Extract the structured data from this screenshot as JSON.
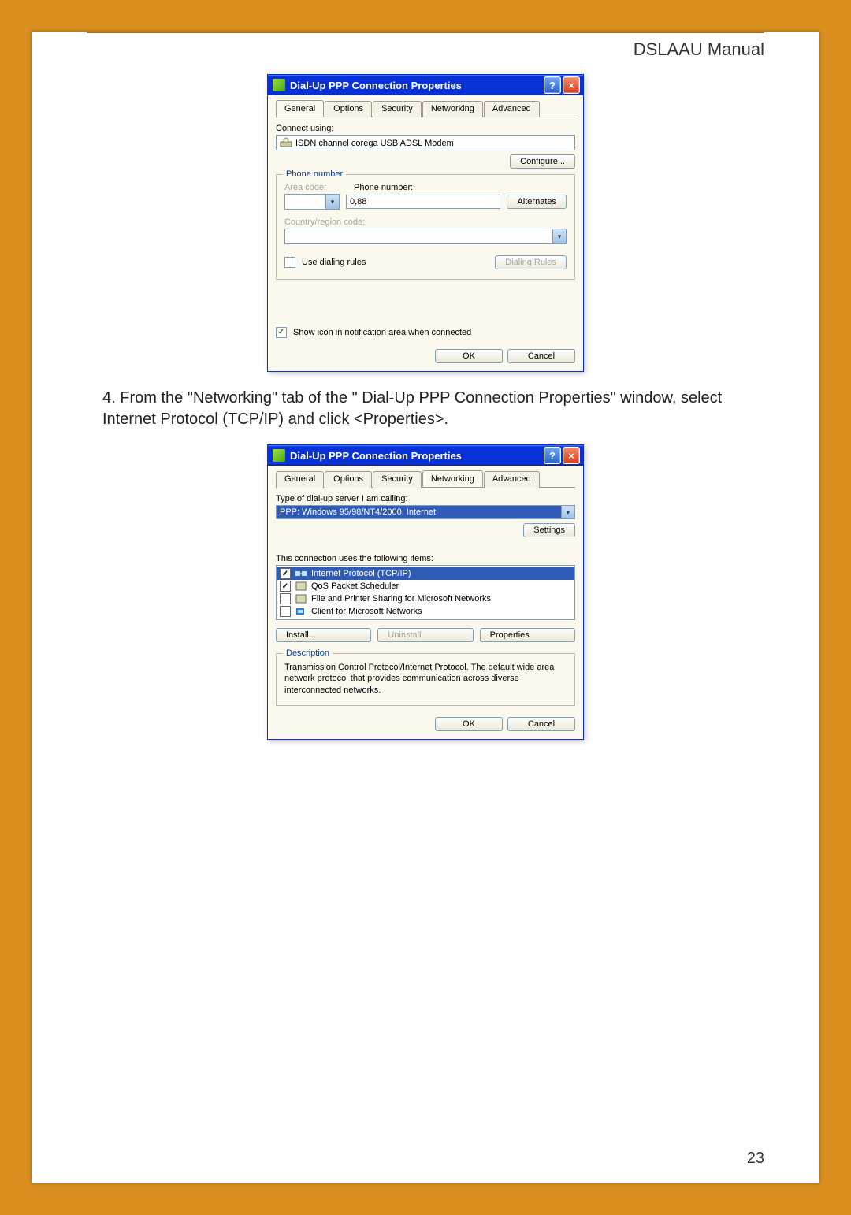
{
  "doc": {
    "header": "DSLAAU Manual",
    "page_number": "23",
    "instruction_number": "4.",
    "instruction_text": "From the \"Networking\" tab of the \" Dial-Up PPP Connection Properties\" window, select Internet Protocol (TCP/IP) and click <Properties>."
  },
  "dialog1": {
    "title": "Dial-Up PPP Connection Properties",
    "tabs": [
      "General",
      "Options",
      "Security",
      "Networking",
      "Advanced"
    ],
    "active_tab": "General",
    "connect_using_label": "Connect using:",
    "connect_using_value": "ISDN  channel  corega USB ADSL Modem",
    "configure_btn": "Configure...",
    "group_phone": "Phone number",
    "area_code_label": "Area code:",
    "phone_number_label": "Phone number:",
    "phone_number_value": "0,88",
    "alternates_btn": "Alternates",
    "country_label": "Country/region code:",
    "dialing_rules_chk": "Use dialing rules",
    "dialing_rules_btn": "Dialing Rules",
    "show_icon_chk": "Show icon in notification area when connected",
    "ok_btn": "OK",
    "cancel_btn": "Cancel"
  },
  "dialog2": {
    "title": "Dial-Up PPP Connection Properties",
    "tabs": [
      "General",
      "Options",
      "Security",
      "Networking",
      "Advanced"
    ],
    "active_tab": "Networking",
    "type_label": "Type of dial-up server I am calling:",
    "type_value": "PPP: Windows 95/98/NT4/2000, Internet",
    "settings_btn": "Settings",
    "items_label": "This connection uses the following items:",
    "items": [
      {
        "checked": true,
        "selected": true,
        "name": "Internet Protocol (TCP/IP)"
      },
      {
        "checked": true,
        "selected": false,
        "name": "QoS Packet Scheduler"
      },
      {
        "checked": false,
        "selected": false,
        "name": "File and Printer Sharing for Microsoft Networks"
      },
      {
        "checked": false,
        "selected": false,
        "name": "Client for Microsoft Networks"
      }
    ],
    "install_btn": "Install...",
    "uninstall_btn": "Uninstall",
    "properties_btn": "Properties",
    "desc_legend": "Description",
    "desc_text": "Transmission Control Protocol/Internet Protocol. The default wide area network protocol that provides communication across diverse interconnected networks.",
    "ok_btn": "OK",
    "cancel_btn": "Cancel"
  }
}
